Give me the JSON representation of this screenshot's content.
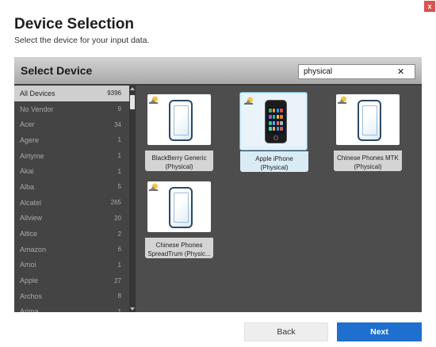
{
  "window": {
    "close_label": "x"
  },
  "page": {
    "title": "Device Selection",
    "subtitle": "Select the device for your input data."
  },
  "panel": {
    "title": "Select Device",
    "search": {
      "value": "physical",
      "clear_label": "✕"
    }
  },
  "vendors": [
    {
      "name": "All Devices",
      "count": "9396",
      "selected": true
    },
    {
      "name": "No Vendor",
      "count": "9"
    },
    {
      "name": "Acer",
      "count": "34"
    },
    {
      "name": "Agere",
      "count": "1"
    },
    {
      "name": "Airtyme",
      "count": "1"
    },
    {
      "name": "Akai",
      "count": "1"
    },
    {
      "name": "Alba",
      "count": "5"
    },
    {
      "name": "Alcatel",
      "count": "265"
    },
    {
      "name": "Allview",
      "count": "20"
    },
    {
      "name": "Altice",
      "count": "2"
    },
    {
      "name": "Amazon",
      "count": "6"
    },
    {
      "name": "Amoi",
      "count": "1"
    },
    {
      "name": "Apple",
      "count": "27"
    },
    {
      "name": "Archos",
      "count": "8"
    },
    {
      "name": "Arima",
      "count": "1"
    }
  ],
  "devices": [
    {
      "name": "BlackBerry Generic\n(Physical)",
      "image": "generic-phone-icon",
      "selected": false
    },
    {
      "name": "Apple iPhone\n(Physical)",
      "image": "iphone-photo",
      "selected": true
    },
    {
      "name": "Chinese Phones MTK\n(Physical)",
      "image": "generic-phone-icon",
      "selected": false
    },
    {
      "name": "Chinese Phones\nSpreadTrum (Physic...",
      "image": "generic-phone-icon",
      "selected": false
    }
  ],
  "footer": {
    "back_label": "Back",
    "next_label": "Next"
  },
  "colors": {
    "accent": "#1f6fcf",
    "close": "#d9534f",
    "selection_border": "#6bb3d6"
  }
}
